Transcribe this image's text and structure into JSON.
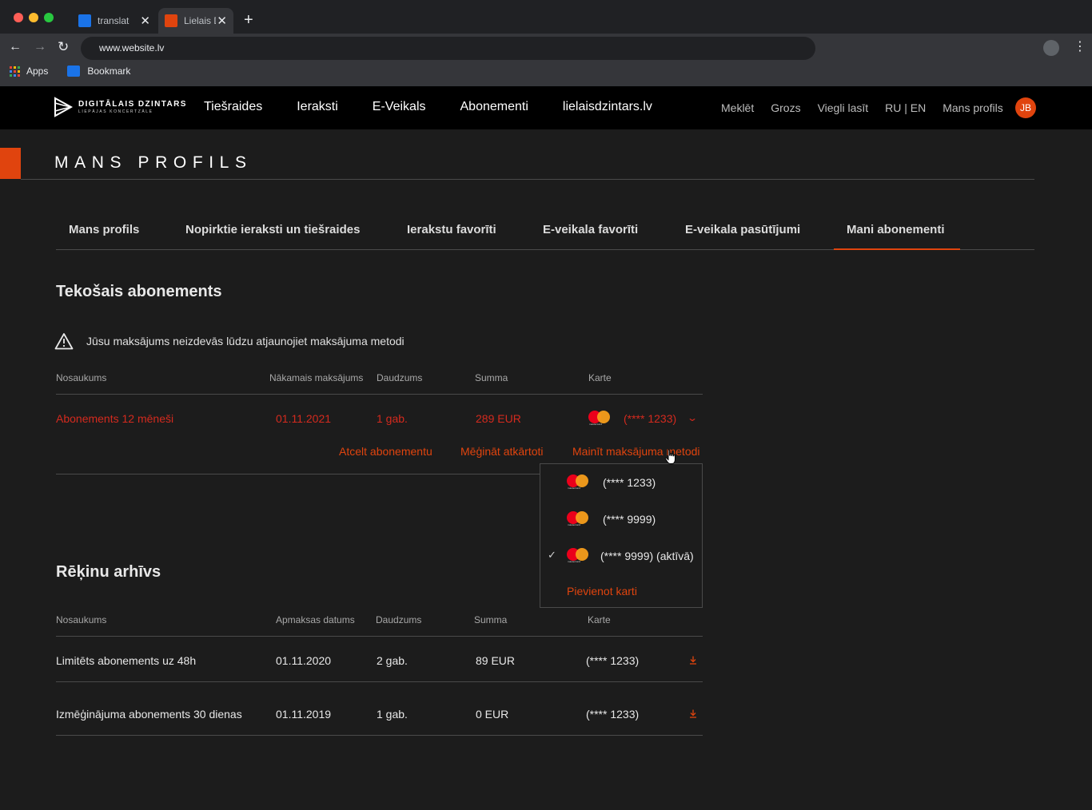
{
  "browser": {
    "tabs": [
      {
        "title": "translate",
        "favicon_color": "#1a73e8"
      },
      {
        "title": "Lielais Dzintars",
        "favicon_color": "#e0440e"
      }
    ],
    "url": "www.website.lv",
    "bookmarks": [
      {
        "label": "Apps"
      },
      {
        "label": "Bookmark"
      }
    ]
  },
  "header": {
    "logo_main": "DIGITĀLAIS DZINTARS",
    "logo_sub": "LIEPĀJAS KONCERTZĀLE",
    "nav": [
      "Tiešraides",
      "Ieraksti",
      "E-Veikals",
      "Abonementi",
      "lielaisdzintars.lv"
    ],
    "utility": [
      "Meklēt",
      "Grozs",
      "Viegli lasīt",
      "RU | EN",
      "Mans profils"
    ],
    "avatar_initials": "JB",
    "accent_color": "#e0440e"
  },
  "page": {
    "title": "MANS PROFILS",
    "tabs": [
      {
        "label": "Mans profils"
      },
      {
        "label": "Nopirktie ieraksti un tiešraides"
      },
      {
        "label": "Ierakstu favorīti"
      },
      {
        "label": "E-veikala favorīti"
      },
      {
        "label": "E-veikala pasūtījumi"
      },
      {
        "label": "Mani abonementi"
      }
    ],
    "active_tab": "Mani abonementi"
  },
  "current": {
    "title": "Tekošais abonements",
    "warning": "Jūsu maksājums neizdevās lūdzu atjaunojiet maksājuma metodi",
    "columns": [
      "Nosaukums",
      "Nākamais maksājums",
      "Daudzums",
      "Summa",
      "Karte"
    ],
    "row": {
      "name": "Abonements 12 mēneši",
      "next_payment": "01.11.2021",
      "quantity": "1 gab.",
      "sum": "289 EUR",
      "card": "(**** 1233)"
    },
    "error_color": "#d42a1e",
    "actions": [
      "Atcelt abonementu",
      "Mēģināt atkārtoti",
      "Mainīt maksājuma metodi"
    ]
  },
  "card_dropdown": {
    "brand_label": "mastercard",
    "items": [
      {
        "label": "(**** 1233)",
        "selected": false
      },
      {
        "label": "(**** 9999)",
        "selected": false
      },
      {
        "label": "(**** 9999) (aktīvā)",
        "selected": true
      }
    ],
    "add_label": "Pievienot karti"
  },
  "archive": {
    "title": "Rēķinu arhīvs",
    "columns": [
      "Nosaukums",
      "Apmaksas datums",
      "Daudzums",
      "Summa",
      "Karte"
    ],
    "rows": [
      {
        "name": "Limitēts abonements uz 48h",
        "date": "01.11.2020",
        "quantity": "2 gab.",
        "sum": "89 EUR",
        "card": "(**** 1233)"
      },
      {
        "name": "Izmēģinājuma abonements 30 dienas",
        "date": "01.11.2019",
        "quantity": "1 gab.",
        "sum": "0 EUR",
        "card": "(**** 1233)"
      }
    ]
  }
}
